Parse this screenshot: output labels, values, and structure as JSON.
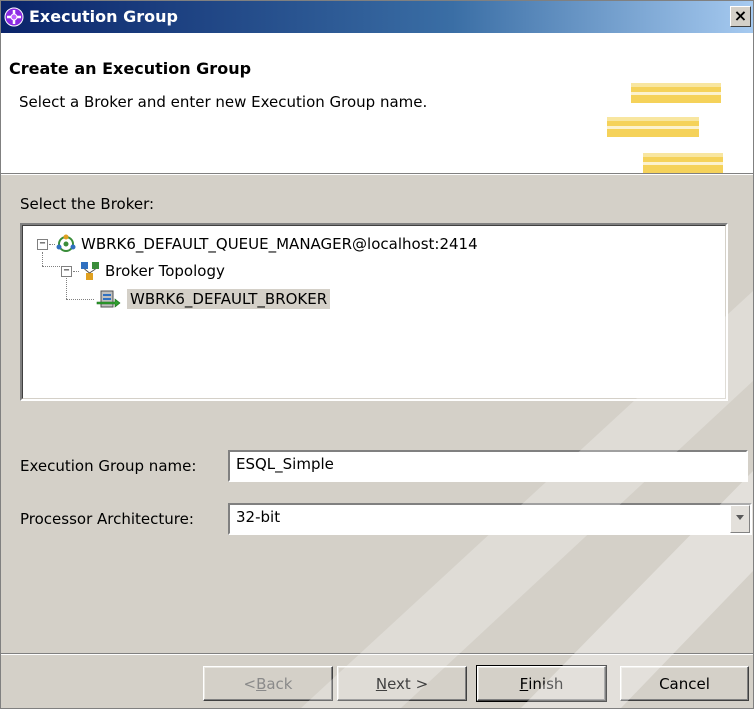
{
  "window": {
    "title": "Execution Group",
    "close_label": "×"
  },
  "header": {
    "title": "Create an Execution Group",
    "description": "Select a Broker and enter new Execution Group name."
  },
  "broker_section": {
    "label": "Select the Broker:"
  },
  "tree": {
    "root": {
      "label": "WBRK6_DEFAULT_QUEUE_MANAGER@localhost:2414",
      "icon": "queue-manager-icon",
      "expander": "−"
    },
    "child": {
      "label": "Broker Topology",
      "icon": "topology-icon",
      "expander": "−"
    },
    "leaf": {
      "label": "WBRK6_DEFAULT_BROKER",
      "icon": "broker-icon",
      "selected": true
    }
  },
  "form": {
    "name_label": "Execution Group name:",
    "name_value": "ESQL_Simple",
    "arch_label": "Processor Architecture:",
    "arch_value": "32-bit"
  },
  "buttons": {
    "back": {
      "pre": "< ",
      "mnemonic": "B",
      "rest": "ack",
      "enabled": false
    },
    "next": {
      "pre": "",
      "mnemonic": "N",
      "rest": "ext >",
      "enabled": true
    },
    "finish": {
      "pre": "",
      "mnemonic": "F",
      "rest": "inish",
      "enabled": true
    },
    "cancel": {
      "label": "Cancel",
      "enabled": true
    }
  },
  "colors": {
    "titlebar_start": "#0a246a",
    "titlebar_end": "#a6caf0",
    "dialog_bg": "#d4d0c8",
    "art_yellow": "#f5d25a"
  }
}
